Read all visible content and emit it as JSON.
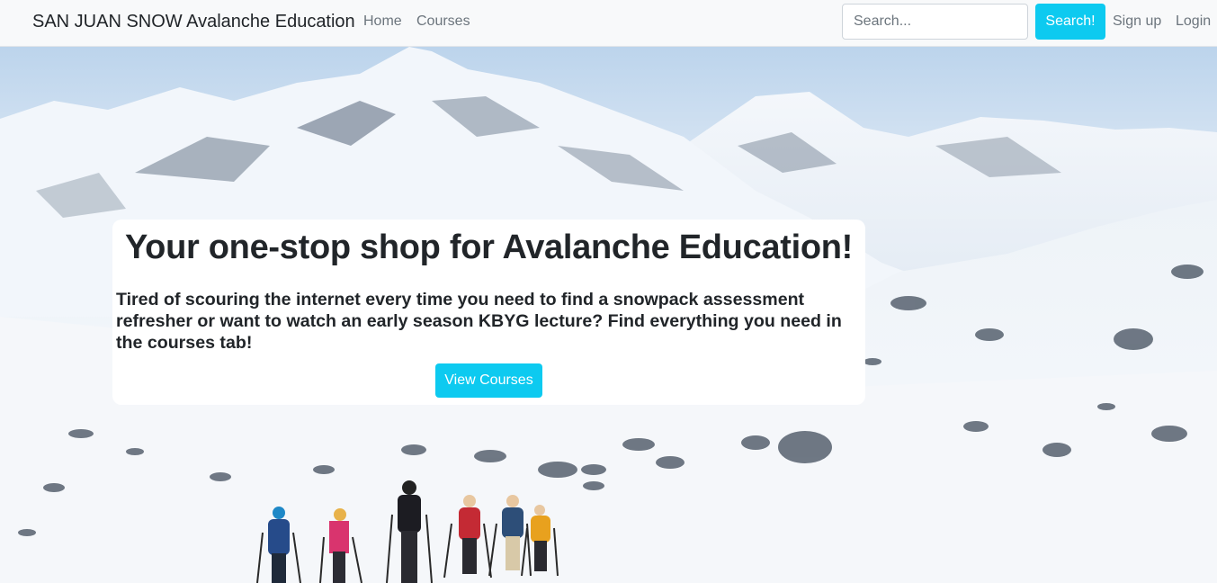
{
  "navbar": {
    "brand": "SAN JUAN SNOW Avalanche Education",
    "links": {
      "home": "Home",
      "courses": "Courses",
      "signup": "Sign up",
      "login": "Login"
    },
    "search": {
      "placeholder": "Search...",
      "value": "",
      "button_label": "Search!"
    }
  },
  "hero": {
    "image": "snowy-mountain-ski-touring-group",
    "card": {
      "title": "Your one-stop shop for Avalanche Education!",
      "text": "Tired of scouring the internet every time you need to find a snowpack assessment refresher or want to watch an early season KBYG lecture? Find everything you need in the courses tab!",
      "button_label": "View Courses"
    }
  },
  "colors": {
    "accent": "#0dcaf0",
    "navbar_bg": "#f8f9fa",
    "text_dark": "#212529",
    "nav_link": "#6c757d"
  }
}
